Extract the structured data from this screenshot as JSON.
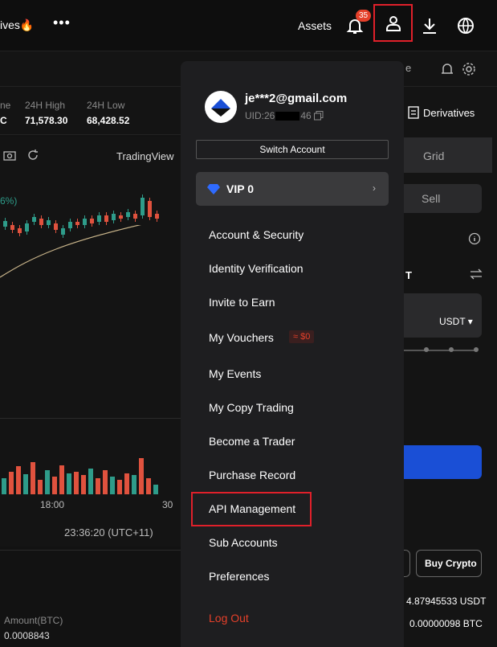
{
  "nav": {
    "label": "ives",
    "flame": "🔥",
    "more": "•••",
    "assets": "Assets",
    "notif_count": "35"
  },
  "stats": {
    "vol_label": "ne",
    "vol_val": "C",
    "high_label": "24H High",
    "high_val": "71,578.30",
    "low_label": "24H Low",
    "low_val": "68,428.52"
  },
  "chart": {
    "provider": "TradingView",
    "pct": "6%)",
    "time_tick": "18:00",
    "date_tick": "30",
    "clock": "23:36:20 (UTC+11)",
    "amount_label": "Amount(BTC)",
    "amount_val": "0.0008843",
    "candles": [
      {
        "o": 282,
        "c": 275,
        "d": "up"
      },
      {
        "o": 286,
        "c": 280,
        "d": "dn"
      },
      {
        "o": 290,
        "c": 284,
        "d": "dn"
      },
      {
        "o": 288,
        "c": 278,
        "d": "up"
      },
      {
        "o": 276,
        "c": 270,
        "d": "up"
      },
      {
        "o": 272,
        "c": 280,
        "d": "dn"
      },
      {
        "o": 280,
        "c": 274,
        "d": "up"
      },
      {
        "o": 278,
        "c": 286,
        "d": "dn"
      },
      {
        "o": 292,
        "c": 284,
        "d": "up"
      },
      {
        "o": 284,
        "c": 276,
        "d": "up"
      },
      {
        "o": 276,
        "c": 280,
        "d": "dn"
      },
      {
        "o": 280,
        "c": 272,
        "d": "up"
      },
      {
        "o": 272,
        "c": 278,
        "d": "dn"
      },
      {
        "o": 276,
        "c": 268,
        "d": "up"
      },
      {
        "o": 268,
        "c": 276,
        "d": "dn"
      },
      {
        "o": 274,
        "c": 266,
        "d": "up"
      },
      {
        "o": 268,
        "c": 272,
        "d": "dn"
      },
      {
        "o": 270,
        "c": 264,
        "d": "up"
      },
      {
        "o": 266,
        "c": 272,
        "d": "dn"
      },
      {
        "o": 268,
        "c": 246,
        "d": "up"
      },
      {
        "o": 250,
        "c": 270,
        "d": "dn"
      },
      {
        "o": 266,
        "c": 272,
        "d": "dn"
      }
    ],
    "volumes": [
      20,
      28,
      35,
      25,
      40,
      18,
      30,
      22,
      36,
      26,
      28,
      24,
      32,
      20,
      30,
      22,
      18,
      26,
      24,
      45,
      20,
      12
    ]
  },
  "panel": {
    "email": "je***2@gmail.com",
    "uid": "UID:26",
    "uid_tail": "46",
    "switch": "Switch Account",
    "vip": "VIP 0",
    "vip_chevron": "›",
    "items": [
      "Account & Security",
      "Identity Verification",
      "Invite to Earn",
      "My Vouchers",
      "My Events",
      "My Copy Trading",
      "Become a Trader",
      "Purchase Record",
      "API Management",
      "Sub Accounts",
      "Preferences",
      "Log Out"
    ],
    "voucher_badge": "≈ $0"
  },
  "right": {
    "derivatives": "Derivatives",
    "grid": "Grid",
    "sell": "Sell",
    "t": "T",
    "unit": "USDT ▾",
    "buy_crypto": "Buy Crypto",
    "bal1": "4.87945533 USDT",
    "bal2": "0.00000098 BTC",
    "e_label": "e"
  },
  "colors": {
    "accent_red": "#e0202a",
    "up": "#2e9c8a",
    "down": "#e0523e",
    "blue": "#1a4fd6"
  }
}
